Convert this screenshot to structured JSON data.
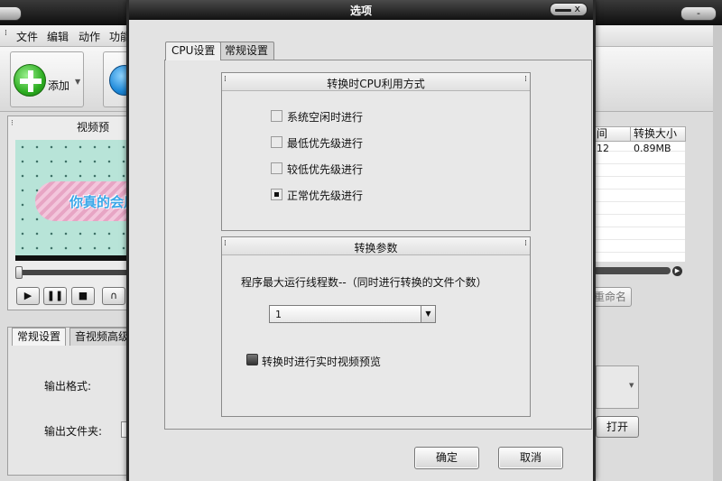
{
  "app": {
    "menu": [
      "文件",
      "编辑",
      "动作",
      "功能"
    ],
    "toolbar": {
      "add_label": "添加"
    },
    "preview": {
      "title": "视频预",
      "video_caption": "你真的会用吗"
    },
    "file_list": {
      "columns": [
        "间",
        "转换大小"
      ],
      "rows": [
        {
          "time": "12",
          "size": "0.89MB"
        }
      ]
    },
    "rename_label": "重命名",
    "bottom_tabs": [
      "常规设置",
      "音视频高级"
    ],
    "output_format_label": "输出格式:",
    "output_folder_label": "输出文件夹:",
    "open_label": "打开",
    "window_controls": {
      "minimize": "-",
      "close": "x"
    }
  },
  "dialog": {
    "title": "选项",
    "close_label": "x",
    "tabs": [
      {
        "label": "CPU设置",
        "active": true
      },
      {
        "label": "常规设置",
        "active": false
      }
    ],
    "cpu_group": {
      "title": "转换时CPU利用方式",
      "options": [
        {
          "label": "系统空闲时进行",
          "checked": false
        },
        {
          "label": "最低优先级进行",
          "checked": false
        },
        {
          "label": "较低优先级进行",
          "checked": false
        },
        {
          "label": "正常优先级进行",
          "checked": true
        }
      ]
    },
    "params_group": {
      "title": "转换参数",
      "threads_label": "程序最大运行线程数--（同时进行转换的文件个数）",
      "threads_value": "1",
      "preview_label": "转换时进行实时视频预览",
      "preview_checked": true
    },
    "ok_label": "确定",
    "cancel_label": "取消"
  },
  "colors": {
    "titlebar": "#111111",
    "dialog_bg": "#e3e3e3",
    "add_icon": "#2eae22",
    "play_icon": "#1d88d8"
  }
}
